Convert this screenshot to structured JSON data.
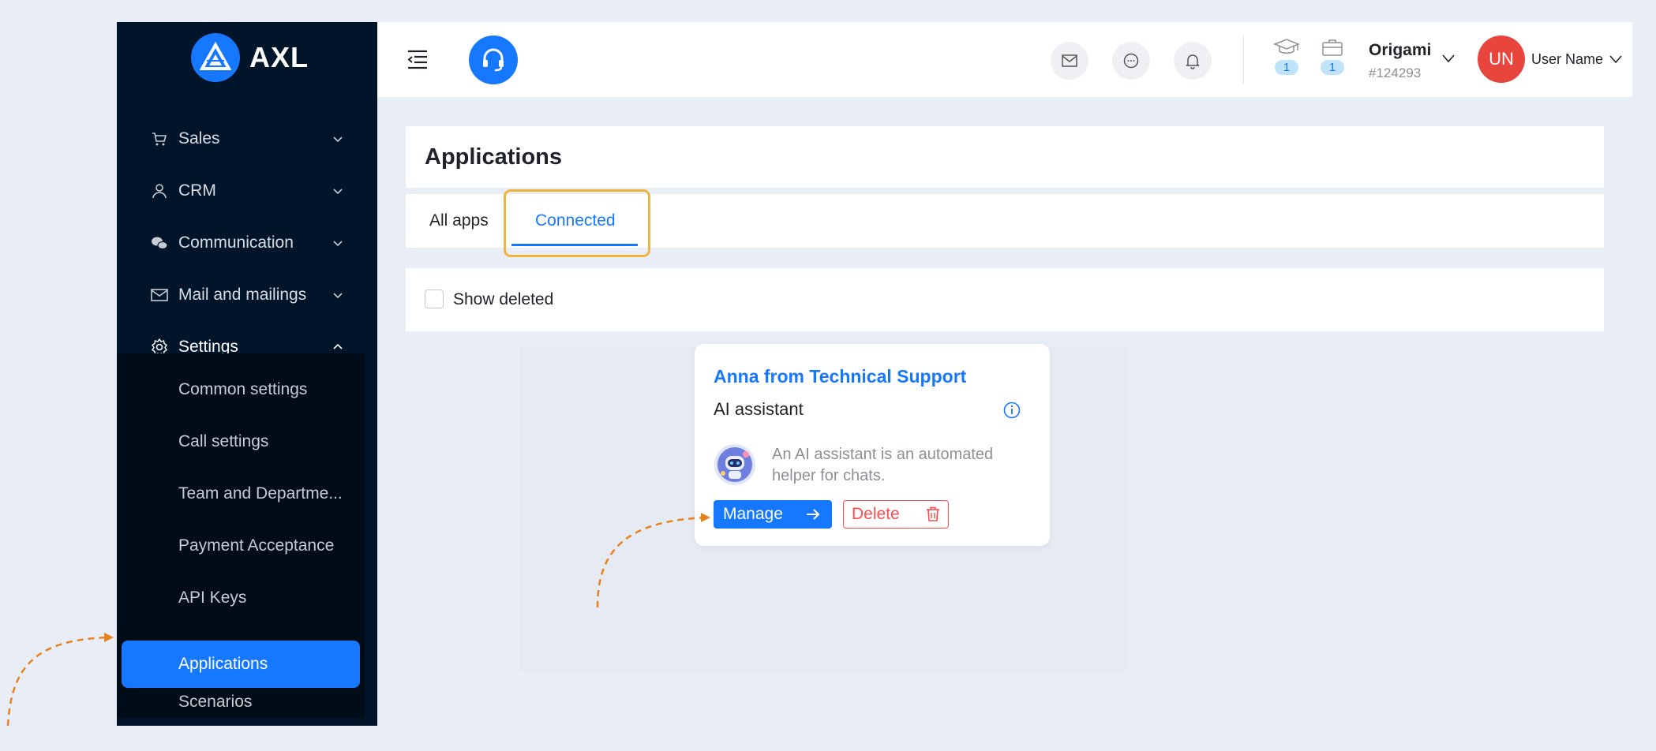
{
  "brand": {
    "name": "AXL"
  },
  "sidebar": {
    "items": [
      {
        "label": "Sales",
        "icon": "cart-icon"
      },
      {
        "label": "CRM",
        "icon": "user-icon"
      },
      {
        "label": "Communication",
        "icon": "wechat-icon"
      },
      {
        "label": "Mail and mailings",
        "icon": "mail-icon"
      },
      {
        "label": "Settings",
        "icon": "gear-icon"
      }
    ],
    "submenu": [
      {
        "label": "Common settings"
      },
      {
        "label": "Call settings"
      },
      {
        "label": "Team and Departme..."
      },
      {
        "label": "Payment Acceptance"
      },
      {
        "label": "API Keys"
      },
      {
        "label": "Applications",
        "active": true
      },
      {
        "label": "Scenarios"
      }
    ]
  },
  "header": {
    "counters": [
      {
        "icon": "graduation-cap-icon",
        "value": "1"
      },
      {
        "icon": "briefcase-icon",
        "value": "1"
      }
    ],
    "org": {
      "name": "Origami",
      "id": "#124293"
    },
    "user": {
      "initials": "UN",
      "name": "User Name"
    }
  },
  "page": {
    "title": "Applications",
    "tabs": [
      {
        "label": "All apps"
      },
      {
        "label": "Connected",
        "active": true
      }
    ],
    "filter": {
      "label": "Show deleted",
      "checked": false
    }
  },
  "app_card": {
    "title": "Anna from Technical Support",
    "type": "AI assistant",
    "description": "An AI assistant is an automated helper for chats.",
    "manage_label": "Manage",
    "delete_label": "Delete"
  },
  "colors": {
    "accent": "#1677ff",
    "sidebar": "#001529",
    "danger": "#ff4d4f",
    "highlight": "#f0b43c",
    "avatar": "#e8453c"
  }
}
